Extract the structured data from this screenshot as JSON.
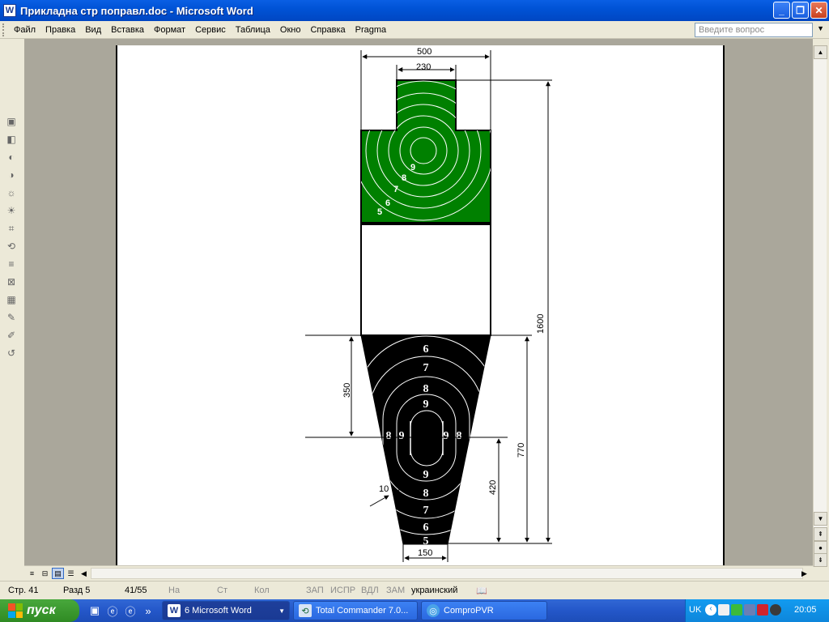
{
  "window": {
    "title": "Прикладна стр поправл.doc - Microsoft Word",
    "app_icon": "word-icon",
    "buttons": {
      "minimize": "_",
      "maximize": "❐",
      "close": "✕"
    }
  },
  "menu": {
    "items": [
      "Файл",
      "Правка",
      "Вид",
      "Вставка",
      "Формат",
      "Сервис",
      "Таблица",
      "Окно",
      "Справка",
      "Pragma"
    ],
    "ask_placeholder": "Введите вопрос"
  },
  "drawing": {
    "top_width_label": "500",
    "head_width_label": "230",
    "height_label": "1600",
    "lower_height_label": "770",
    "upper_gap_label": "350",
    "center_height_label": "420",
    "bottom_width_label": "150",
    "ten_label": "10",
    "green_ring_labels": [
      "9",
      "8",
      "7",
      "6",
      "5"
    ],
    "black_top_labels": [
      "6",
      "7",
      "8",
      "9"
    ],
    "black_side_labels": [
      "8",
      "9",
      "9",
      "8"
    ],
    "black_bottom_labels": [
      "9",
      "8",
      "7",
      "6",
      "5"
    ],
    "colors": {
      "green": "#008000",
      "black": "#000000",
      "white": "#ffffff"
    }
  },
  "status": {
    "page": "Стр. 41",
    "section": "Разд 5",
    "pages": "41/55",
    "at": "На",
    "line": "Ст",
    "col": "Кол",
    "rec": "ЗАП",
    "trk": "ИСПР",
    "ext": "ВДЛ",
    "ovr": "ЗАМ",
    "language": "украинский"
  },
  "taskbar": {
    "start_label": "пуск",
    "tasks": [
      {
        "label": "6 Microsoft Word",
        "icon": "word-icon",
        "active": true
      },
      {
        "label": "Total Commander 7.0...",
        "icon": "total-commander-icon",
        "active": false
      },
      {
        "label": "ComproPVR",
        "icon": "compropvr-icon",
        "active": false
      }
    ],
    "lang": "UK",
    "clock": "20:05"
  }
}
